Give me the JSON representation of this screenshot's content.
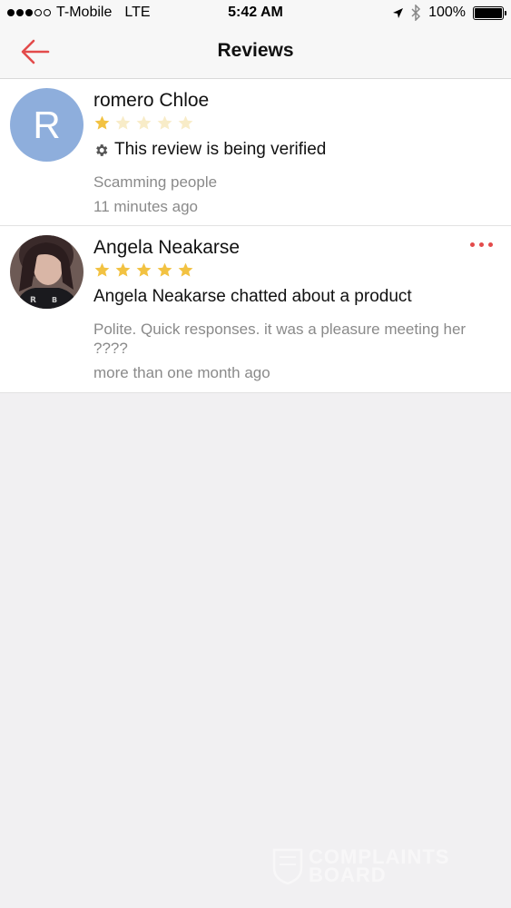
{
  "status_bar": {
    "carrier": "T-Mobile",
    "network": "LTE",
    "time": "5:42 AM",
    "battery": "100%"
  },
  "nav": {
    "title": "Reviews",
    "back_icon": "arrow-left-icon",
    "accent_color": "#e34b4b"
  },
  "reviews": [
    {
      "name": "romero Chloe",
      "avatar_initial": "R",
      "rating": 1,
      "max_rating": 5,
      "status": "This review is being verified",
      "status_icon": "gear-icon",
      "body": "Scamming people",
      "time": "11 minutes ago"
    },
    {
      "name": "Angela Neakarse",
      "rating": 5,
      "max_rating": 5,
      "headline": "Angela Neakarse chatted about a product",
      "body": "Polite. Quick responses. it was a pleasure meeting her ????",
      "time": "more than one month ago",
      "more_icon": "more-dots-icon"
    }
  ],
  "watermark": {
    "line1": "COMPLAINTS",
    "line2": "BOARD"
  }
}
